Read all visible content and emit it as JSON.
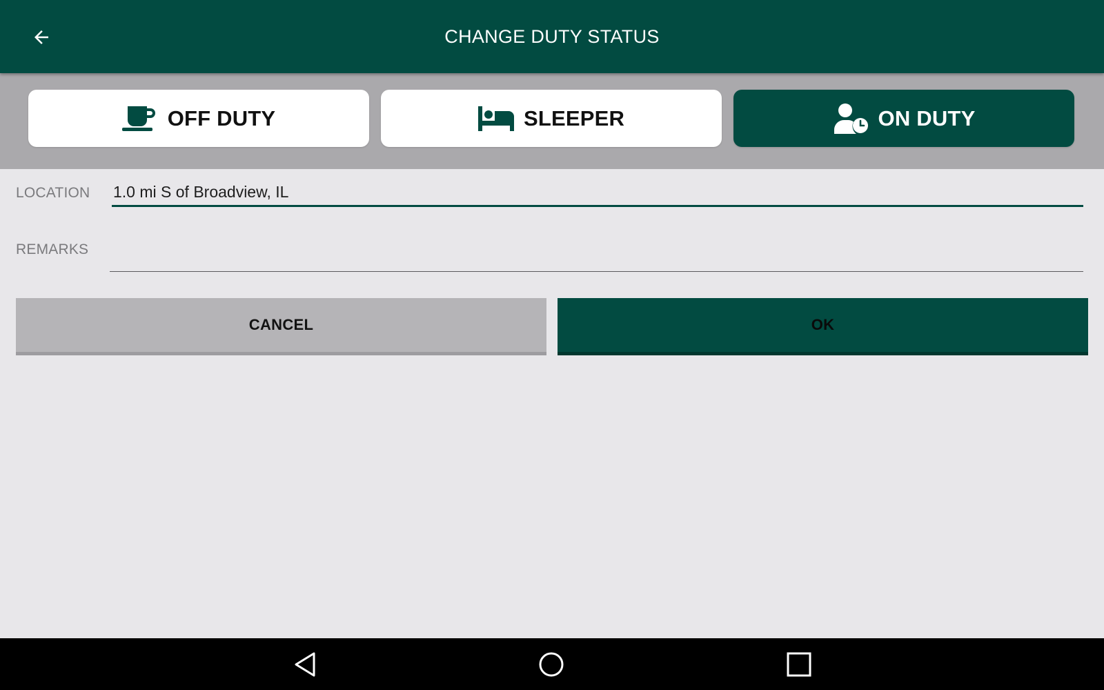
{
  "header": {
    "title": "CHANGE DUTY STATUS",
    "back_icon": "arrow-left-icon"
  },
  "status_options": [
    {
      "label": "OFF DUTY",
      "icon": "coffee-cup-icon",
      "selected": false
    },
    {
      "label": "SLEEPER",
      "icon": "bed-icon",
      "selected": false
    },
    {
      "label": "ON DUTY",
      "icon": "person-clock-icon",
      "selected": true
    }
  ],
  "form": {
    "location_label": "LOCATION",
    "location_value": "1.0 mi S of Broadview, IL",
    "remarks_label": "REMARKS",
    "remarks_value": ""
  },
  "actions": {
    "cancel_label": "CANCEL",
    "ok_label": "OK"
  },
  "nav": {
    "back_icon": "nav-back-triangle-icon",
    "home_icon": "nav-home-circle-icon",
    "recents_icon": "nav-recents-square-icon"
  },
  "colors": {
    "primary": "#024b41",
    "background": "#e8e7ea",
    "status_bar": "#aaa9ac",
    "cancel": "#b5b4b7",
    "nav_bar": "#000000"
  }
}
